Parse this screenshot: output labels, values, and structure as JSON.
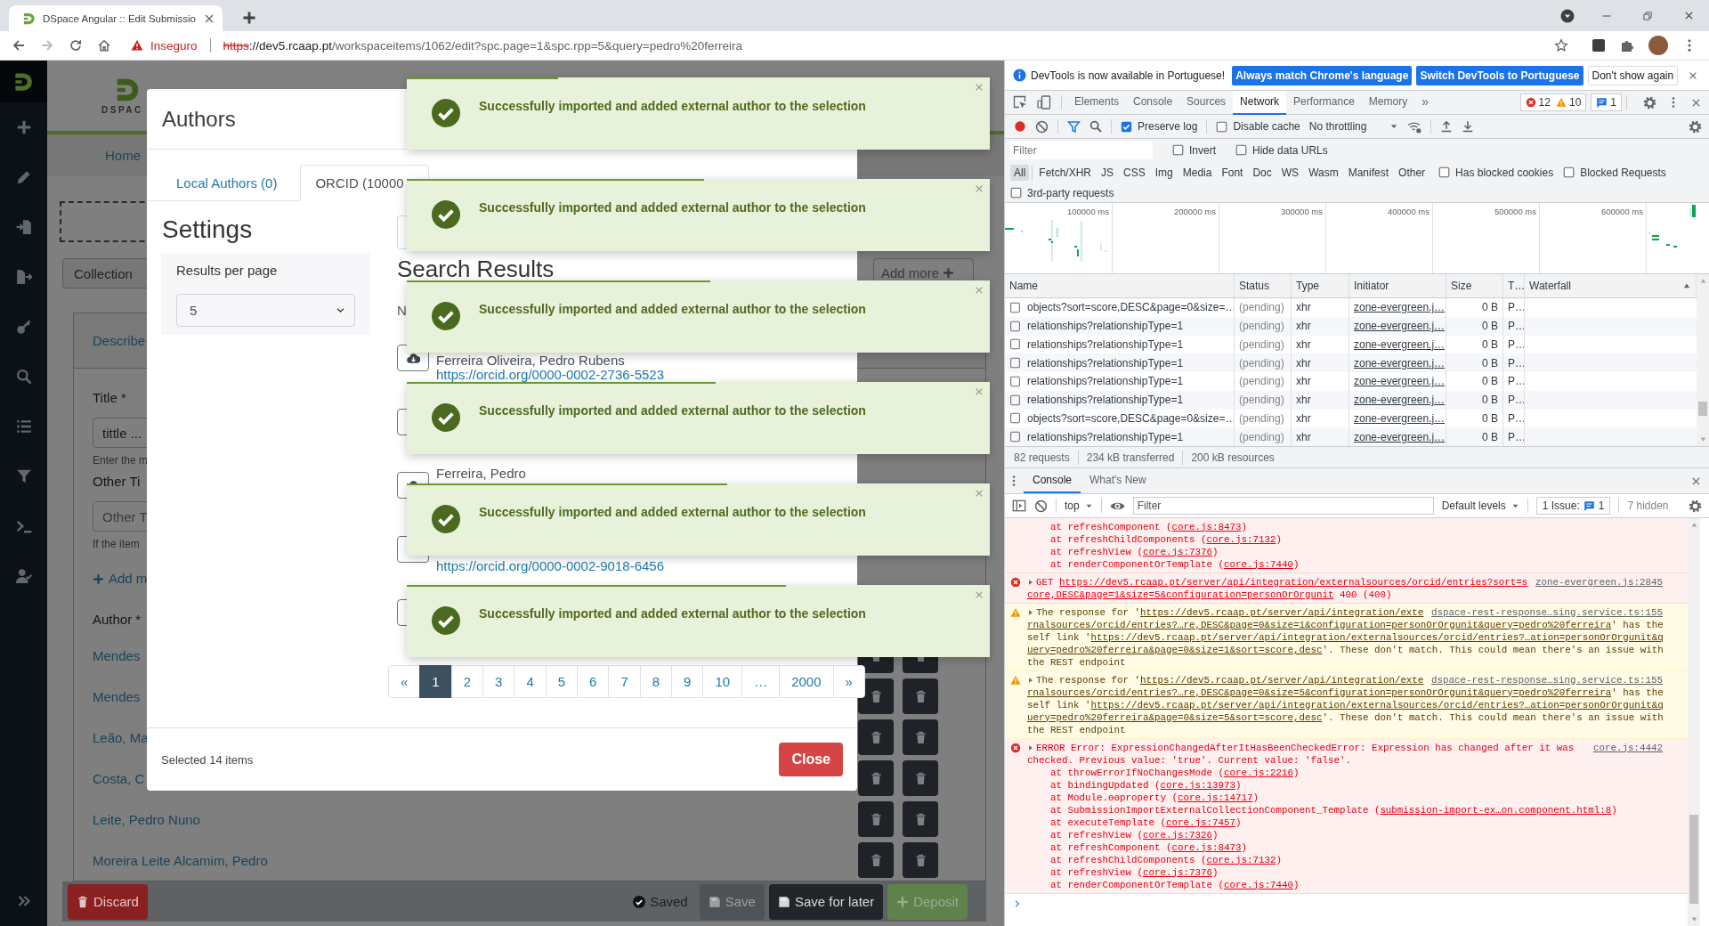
{
  "browser": {
    "tab_title": "DSpace Angular :: Edit Submissio",
    "security_label": "Inseguro",
    "url": {
      "scheme": "https",
      "host": "://dev5.rcaap.pt",
      "path": "/workspaceitems/1062/edit?spc.page=1&spc.rpp=5&query=pedro%20ferreira"
    }
  },
  "app": {
    "logo_text": "DSPAC",
    "nav": [
      "Home"
    ],
    "collection_button": "Collection",
    "add_more_button": "Add more",
    "section_tab": "Describe",
    "fields": [
      {
        "label": "Title *",
        "value": "tittle ...",
        "hint": "Enter the m"
      },
      {
        "label": "Other Ti",
        "placeholder": "Other T",
        "hint": "If the item"
      }
    ],
    "add_more_link": "Add m",
    "author_label": "Author *",
    "authors": [
      "Mendes",
      "Mendes",
      "Leão, Ma",
      "Costa, C",
      "Leite, Pedro Nuno",
      "Moreira Leite Alcamim, Pedro"
    ],
    "actions": [
      {
        "kind": "discard",
        "label": "Discard",
        "disabled": false
      },
      {
        "kind": "status",
        "label": "Saved"
      },
      {
        "kind": "save",
        "label": "Save",
        "disabled": true
      },
      {
        "kind": "save-later",
        "label": "Save for later",
        "disabled": false
      },
      {
        "kind": "deposit",
        "label": "Deposit",
        "disabled": true
      }
    ]
  },
  "modal": {
    "title": "Authors",
    "tabs": [
      {
        "label": "Local Authors (0)",
        "selected": false
      },
      {
        "label": "ORCID (10000",
        "selected": true
      }
    ],
    "settings_title": "Settings",
    "results_per_page": {
      "label": "Results per page",
      "value": "5"
    },
    "results_title": "Search Results",
    "results_count": "N",
    "results": [
      {
        "kind": "import",
        "name": "Ferreira Oliveira, Pedro Rubens",
        "url": "https://orcid.org/0000-0002-2736-5523"
      },
      {
        "kind": "import"
      },
      {
        "kind": "import",
        "name": "Ferreira, Pedro"
      },
      {
        "kind": "import",
        "url": "https://orcid.org/0000-0002-9018-6456"
      },
      {
        "kind": "import"
      }
    ],
    "pages": [
      {
        "label": "«",
        "selected": false
      },
      {
        "label": "1",
        "selected": true
      },
      {
        "label": "2",
        "selected": false
      },
      {
        "label": "3",
        "selected": false
      },
      {
        "label": "4",
        "selected": false
      },
      {
        "label": "5",
        "selected": false
      },
      {
        "label": "6",
        "selected": false
      },
      {
        "label": "7",
        "selected": false
      },
      {
        "label": "8",
        "selected": false
      },
      {
        "label": "9",
        "selected": false
      },
      {
        "label": "10",
        "selected": false
      },
      {
        "label": "…",
        "selected": false
      },
      {
        "label": "2000",
        "selected": false
      },
      {
        "label": "»",
        "selected": false
      }
    ],
    "selected_count": "Selected 14 items",
    "close_button": "Close"
  },
  "toasts": [
    {
      "message": "Successfully imported and added external author to the selection",
      "level": 0.26
    },
    {
      "message": "Successfully imported and added external author to the selection",
      "level": 0.51
    },
    {
      "message": "Successfully imported and added external author to the selection",
      "level": 0.52
    },
    {
      "message": "Successfully imported and added external author to the selection",
      "level": 0.53
    },
    {
      "message": "Successfully imported and added external author to the selection",
      "level": 0.55
    },
    {
      "message": "Successfully imported and added external author to the selection",
      "level": 0.65
    }
  ],
  "devtools": {
    "infobar": {
      "message": "DevTools is now available in Portuguese!",
      "buttons": [
        {
          "kind": "primary",
          "label": "Always match Chrome's language"
        },
        {
          "kind": "primary",
          "label": "Switch DevTools to Portuguese"
        },
        {
          "kind": "plain",
          "label": "Don't show again"
        }
      ]
    },
    "panels": [
      {
        "label": "Elements",
        "selected": false
      },
      {
        "label": "Console",
        "selected": false
      },
      {
        "label": "Sources",
        "selected": false
      },
      {
        "label": "Network",
        "selected": true
      },
      {
        "label": "Performance",
        "selected": false
      },
      {
        "label": "Memory",
        "selected": false
      }
    ],
    "more_panels": "»",
    "counts": {
      "errors": "12",
      "warnings": "10",
      "messages": "1"
    },
    "network": {
      "preserve_log": {
        "label": "Preserve log",
        "checked": true
      },
      "disable_cache": {
        "label": "Disable cache",
        "checked": false
      },
      "throttling": "No throttling",
      "filter_placeholder": "Filter",
      "invert": {
        "label": "Invert",
        "checked": false
      },
      "hide_data_urls": {
        "label": "Hide data URLs",
        "checked": false
      },
      "types": [
        {
          "label": "All",
          "selected": true
        },
        {
          "label": "Fetch/XHR",
          "selected": false
        },
        {
          "label": "JS",
          "selected": false
        },
        {
          "label": "CSS",
          "selected": false
        },
        {
          "label": "Img",
          "selected": false
        },
        {
          "label": "Media",
          "selected": false
        },
        {
          "label": "Font",
          "selected": false
        },
        {
          "label": "Doc",
          "selected": false
        },
        {
          "label": "WS",
          "selected": false
        },
        {
          "label": "Wasm",
          "selected": false
        },
        {
          "label": "Manifest",
          "selected": false
        },
        {
          "label": "Other",
          "selected": false
        }
      ],
      "blocked_cookies": {
        "label": "Has blocked cookies",
        "checked": false
      },
      "blocked_requests": {
        "label": "Blocked Requests",
        "checked": false
      },
      "third_party": {
        "label": "3rd-party requests",
        "checked": false
      },
      "overview_ticks": [
        "100000 ms",
        "200000 ms",
        "300000 ms",
        "400000 ms",
        "500000 ms",
        "600000 ms"
      ],
      "columns": [
        "Name",
        "Status",
        "Type",
        "Initiator",
        "Size",
        "T…",
        "Waterfall"
      ],
      "rows": [
        {
          "name": "objects?sort=score,DESC&page=0&size=…",
          "status": "(pending)",
          "type": "xhr",
          "initiator": "zone-evergreen.j…",
          "size": "0 B",
          "time": "P…"
        },
        {
          "name": "relationships?relationshipType=1",
          "status": "(pending)",
          "type": "xhr",
          "initiator": "zone-evergreen.j…",
          "size": "0 B",
          "time": "P…"
        },
        {
          "name": "relationships?relationshipType=1",
          "status": "(pending)",
          "type": "xhr",
          "initiator": "zone-evergreen.j…",
          "size": "0 B",
          "time": "P…"
        },
        {
          "name": "relationships?relationshipType=1",
          "status": "(pending)",
          "type": "xhr",
          "initiator": "zone-evergreen.j…",
          "size": "0 B",
          "time": "P…"
        },
        {
          "name": "relationships?relationshipType=1",
          "status": "(pending)",
          "type": "xhr",
          "initiator": "zone-evergreen.j…",
          "size": "0 B",
          "time": "P…"
        },
        {
          "name": "relationships?relationshipType=1",
          "status": "(pending)",
          "type": "xhr",
          "initiator": "zone-evergreen.j…",
          "size": "0 B",
          "time": "P…"
        },
        {
          "name": "objects?sort=score,DESC&page=0&size=…",
          "status": "(pending)",
          "type": "xhr",
          "initiator": "zone-evergreen.j…",
          "size": "0 B",
          "time": "P…"
        },
        {
          "name": "relationships?relationshipType=1",
          "status": "(pending)",
          "type": "xhr",
          "initiator": "zone-evergreen.j…",
          "size": "0 B",
          "time": "P…"
        }
      ],
      "summary": [
        "82 requests",
        "234 kB transferred",
        "200 kB resources"
      ]
    },
    "drawer": {
      "tabs": [
        {
          "label": "Console",
          "selected": true
        },
        {
          "label": "What's New",
          "selected": false
        }
      ],
      "context": "top",
      "filter_placeholder": "Filter",
      "levels": "Default levels",
      "issues": {
        "label": "1 Issue:",
        "count": "1"
      },
      "hidden": "7 hidden",
      "messages": [
        {
          "kind": "error-tail",
          "lines": [
            [
              {
                "text": "    at refreshComponent (",
                "link": false
              },
              {
                "text": "core.js:8473",
                "link": true
              },
              {
                "text": ")",
                "link": false
              }
            ],
            [
              {
                "text": "    at refreshChildComponents (",
                "link": false
              },
              {
                "text": "core.js:7132",
                "link": true
              },
              {
                "text": ")",
                "link": false
              }
            ],
            [
              {
                "text": "    at refreshView (",
                "link": false
              },
              {
                "text": "core.js:7376",
                "link": true
              },
              {
                "text": ")",
                "link": false
              }
            ],
            [
              {
                "text": "    at renderComponentOrTemplate (",
                "link": false
              },
              {
                "text": "core.js:7440",
                "link": true
              },
              {
                "text": ")",
                "link": false
              }
            ]
          ]
        },
        {
          "kind": "error",
          "source": "zone-evergreen.js:2845",
          "lines": [
            [
              {
                "text": "GET ",
                "link": false
              },
              {
                "text": "https://dev5.rcaap.pt/server/api/integration/externalsources/orcid/entries?sort=s",
                "link": true
              }
            ],
            [
              {
                "text": "core,DESC&page=1&size=5&configuration=personOrOrgunit",
                "link": true
              },
              {
                "text": " 400 (400)",
                "link": false
              }
            ]
          ]
        },
        {
          "kind": "warning",
          "source": "dspace-rest-response…sing.service.ts:155",
          "lines": [
            [
              {
                "text": "The response for '",
                "link": false
              },
              {
                "text": "https://dev5.rcaap.pt/server/api/integration/exte",
                "link": true
              }
            ],
            [
              {
                "text": "rnalsources/orcid/entries?…re,DESC&page=0&size=1&configuration=personOrOrgunit&query=pedro%20ferreira",
                "link": true
              },
              {
                "text": "' has the",
                "link": false
              }
            ],
            [
              {
                "text": "self link '",
                "link": false
              },
              {
                "text": "https://dev5.rcaap.pt/server/api/integration/externalsources/orcid/entries?…ation=personOrOrgunit&q",
                "link": true
              }
            ],
            [
              {
                "text": "uery=pedro%20ferreira&page=0&size=1&sort=score,desc",
                "link": true
              },
              {
                "text": "'. These don't match. This could mean there's an issue with",
                "link": false
              }
            ],
            [
              {
                "text": "the REST endpoint",
                "link": false
              }
            ]
          ]
        },
        {
          "kind": "warning",
          "source": "dspace-rest-response…sing.service.ts:155",
          "lines": [
            [
              {
                "text": "The response for '",
                "link": false
              },
              {
                "text": "https://dev5.rcaap.pt/server/api/integration/exte",
                "link": true
              }
            ],
            [
              {
                "text": "rnalsources/orcid/entries?…re,DESC&page=0&size=5&configuration=personOrOrgunit&query=pedro%20ferreira",
                "link": true
              },
              {
                "text": "' has the",
                "link": false
              }
            ],
            [
              {
                "text": "self link '",
                "link": false
              },
              {
                "text": "https://dev5.rcaap.pt/server/api/integration/externalsources/orcid/entries?…ation=personOrOrgunit&q",
                "link": true
              }
            ],
            [
              {
                "text": "uery=pedro%20ferreira&page=0&size=5&sort=score,desc",
                "link": true
              },
              {
                "text": "'. These don't match. This could mean there's an issue with",
                "link": false
              }
            ],
            [
              {
                "text": "the REST endpoint",
                "link": false
              }
            ]
          ]
        },
        {
          "kind": "error",
          "source": "core.js:4442",
          "lines": [
            [
              {
                "text": "ERROR Error: ExpressionChangedAfterItHasBeenCheckedError: Expression has changed after it was",
                "link": false
              }
            ],
            [
              {
                "text": "checked. Previous value: 'true'. Current value: 'false'.",
                "link": false
              }
            ],
            [
              {
                "text": "    at throwErrorIfNoChangesMode (",
                "link": false
              },
              {
                "text": "core.js:2216",
                "link": true
              },
              {
                "text": ")",
                "link": false
              }
            ],
            [
              {
                "text": "    at bindingUpdated (",
                "link": false
              },
              {
                "text": "core.js:13973",
                "link": true
              },
              {
                "text": ")",
                "link": false
              }
            ],
            [
              {
                "text": "    at Module.ɵɵproperty (",
                "link": false
              },
              {
                "text": "core.js:14717",
                "link": true
              },
              {
                "text": ")",
                "link": false
              }
            ],
            [
              {
                "text": "    at SubmissionImportExternalCollectionComponent_Template (",
                "link": false
              },
              {
                "text": "submission-import-ex…on.component.html:8",
                "link": true
              },
              {
                "text": ")",
                "link": false
              }
            ],
            [
              {
                "text": "    at executeTemplate (",
                "link": false
              },
              {
                "text": "core.js:7457",
                "link": true
              },
              {
                "text": ")",
                "link": false
              }
            ],
            [
              {
                "text": "    at refreshView (",
                "link": false
              },
              {
                "text": "core.js:7326",
                "link": true
              },
              {
                "text": ")",
                "link": false
              }
            ],
            [
              {
                "text": "    at refreshComponent (",
                "link": false
              },
              {
                "text": "core.js:8473",
                "link": true
              },
              {
                "text": ")",
                "link": false
              }
            ],
            [
              {
                "text": "    at refreshChildComponents (",
                "link": false
              },
              {
                "text": "core.js:7132",
                "link": true
              },
              {
                "text": ")",
                "link": false
              }
            ],
            [
              {
                "text": "    at refreshView (",
                "link": false
              },
              {
                "text": "core.js:7376",
                "link": true
              },
              {
                "text": ")",
                "link": false
              }
            ],
            [
              {
                "text": "    at renderComponentOrTemplate (",
                "link": false
              },
              {
                "text": "core.js:7440",
                "link": true
              },
              {
                "text": ")",
                "link": false
              }
            ]
          ]
        }
      ]
    }
  }
}
